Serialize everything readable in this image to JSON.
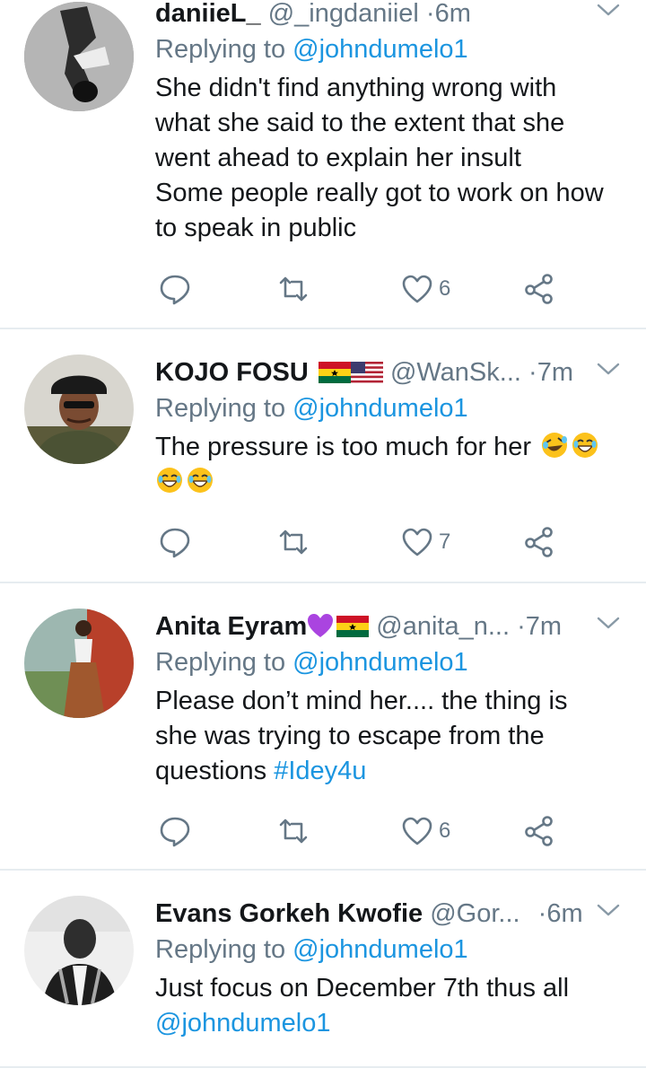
{
  "tweets": [
    {
      "name": "daniieL_",
      "handle": "@_ingdaniiel",
      "dot": "·",
      "time": "6m",
      "replying_prefix": "Replying to",
      "replying_to": "@johndumelo1",
      "lines": [
        "She didn't find anything wrong with",
        "what she said to the extent that she",
        "went ahead to explain her insult",
        "Some people really got to work on how",
        "to speak in public"
      ],
      "likes": "6",
      "name_emoji": []
    },
    {
      "name": "KOJO FOSU",
      "handle": "@WanSk...",
      "dot": "·",
      "time": "7m",
      "replying_prefix": "Replying to",
      "replying_to": "@johndumelo1",
      "lines": [
        "The pressure is too much for her"
      ],
      "likes": "7",
      "name_emoji": [
        "ghana-flag",
        "us-flag"
      ],
      "text_emoji": [
        "rolling-laughing-emoji",
        "grinning-sweat-emoji",
        "grinning-sweat-emoji",
        "grinning-sweat-emoji"
      ]
    },
    {
      "name": "Anita Eyram",
      "handle": "@anita_n...",
      "dot": "·",
      "time": "7m",
      "replying_prefix": "Replying to",
      "replying_to": "@johndumelo1",
      "lines": [
        "Please don’t mind her.... the thing is",
        "she was trying to escape from the",
        "questions"
      ],
      "hashtag": "#Idey4u",
      "likes": "6",
      "name_emoji": [
        "purple-heart",
        "ghana-flag"
      ]
    },
    {
      "name": "Evans Gorkeh Kwofie",
      "handle": "@Gor...",
      "dot": "·",
      "time": "6m",
      "replying_prefix": "Replying to",
      "replying_to": "@johndumelo1",
      "lines": [
        "Just focus on December 7th thus all"
      ],
      "mention_line": "@johndumelo1",
      "name_emoji": []
    }
  ],
  "colors": {
    "link": "#1b95e0",
    "muted": "#657786",
    "text": "#14171a",
    "icon": "#657786"
  }
}
